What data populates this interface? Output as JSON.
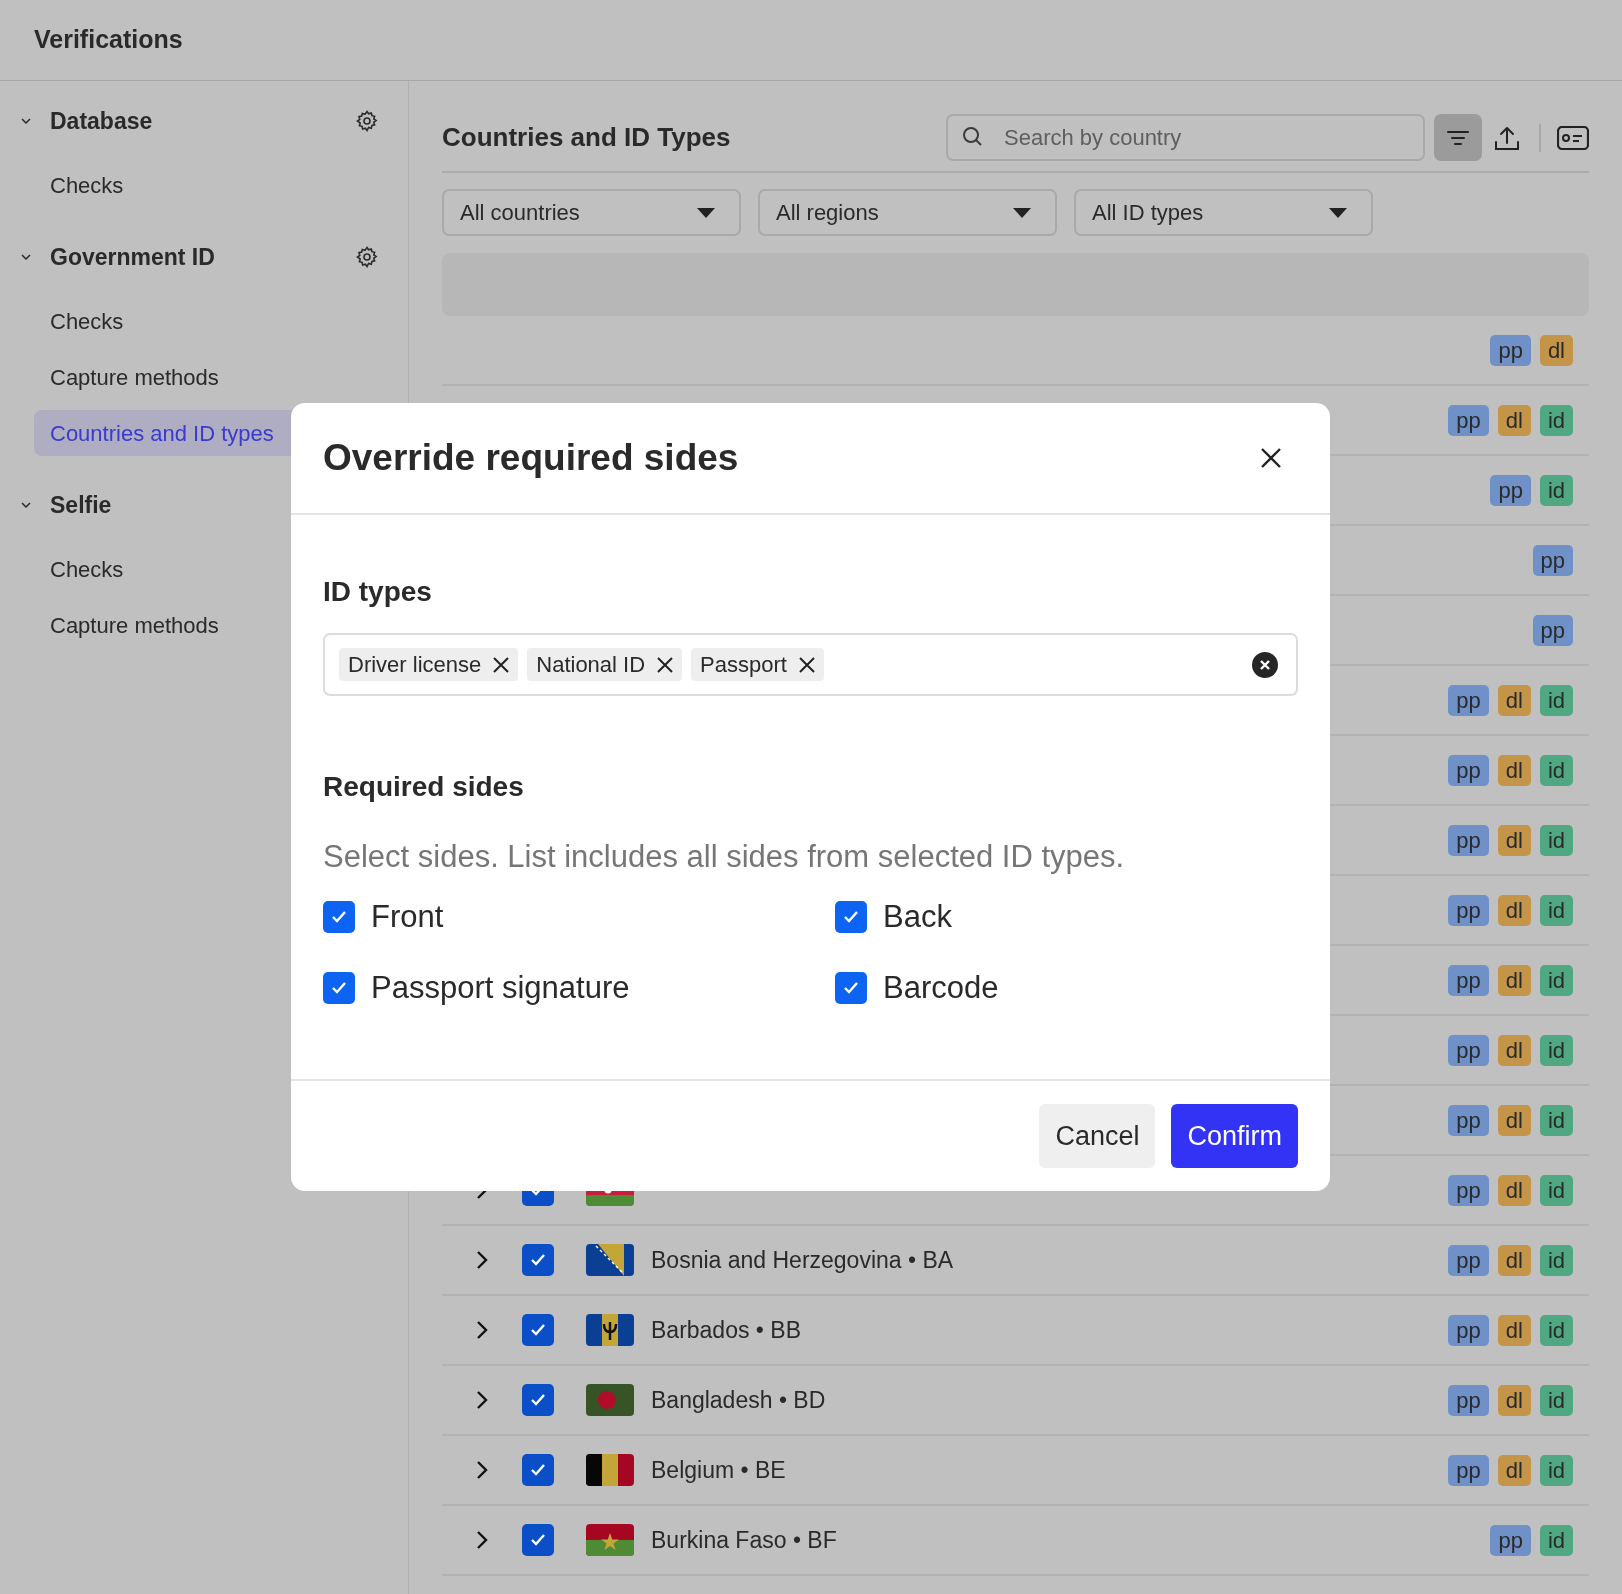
{
  "app": {
    "title": "Verifications"
  },
  "sidebar": {
    "sections": [
      {
        "label": "Database",
        "expanded": true,
        "settings": true,
        "items": [
          {
            "label": "Checks",
            "selected": false
          }
        ]
      },
      {
        "label": "Government ID",
        "expanded": true,
        "settings": true,
        "items": [
          {
            "label": "Checks",
            "selected": false
          },
          {
            "label": "Capture methods",
            "selected": false
          },
          {
            "label": "Countries and ID types",
            "selected": true
          }
        ]
      },
      {
        "label": "Selfie",
        "expanded": true,
        "settings": false,
        "items": [
          {
            "label": "Checks",
            "selected": false
          },
          {
            "label": "Capture methods",
            "selected": false
          }
        ]
      }
    ]
  },
  "main": {
    "title": "Countries and ID Types",
    "search": {
      "placeholder": "Search by country"
    },
    "filter_active": true,
    "filters": [
      "All countries",
      "All regions",
      "All ID types"
    ],
    "rows": [
      {
        "badges": [
          {
            "label": "pp",
            "color": "#7090c8"
          },
          {
            "label": "dl",
            "color": "#c49448"
          }
        ]
      },
      {
        "badges": [
          {
            "label": "pp",
            "color": "#7090c8"
          },
          {
            "label": "dl",
            "color": "#c49448"
          },
          {
            "label": "id",
            "color": "#50a882"
          }
        ]
      },
      {
        "badges": [
          {
            "label": "pp",
            "color": "#7090c8"
          },
          {
            "label": "id",
            "color": "#50a882"
          }
        ]
      },
      {
        "badges": [
          {
            "label": "pp",
            "color": "#7090c8"
          }
        ]
      },
      {
        "badges": [
          {
            "label": "pp",
            "color": "#7090c8"
          }
        ]
      },
      {
        "badges": [
          {
            "label": "pp",
            "color": "#7090c8"
          },
          {
            "label": "dl",
            "color": "#c49448"
          },
          {
            "label": "id",
            "color": "#50a882"
          }
        ]
      },
      {
        "badges": [
          {
            "label": "pp",
            "color": "#7090c8"
          },
          {
            "label": "dl",
            "color": "#c49448"
          },
          {
            "label": "id",
            "color": "#50a882"
          }
        ]
      },
      {
        "badges": [
          {
            "label": "pp",
            "color": "#7090c8"
          },
          {
            "label": "dl",
            "color": "#c49448"
          },
          {
            "label": "id",
            "color": "#50a882"
          }
        ]
      },
      {
        "badges": [
          {
            "label": "pp",
            "color": "#7090c8"
          },
          {
            "label": "dl",
            "color": "#c49448"
          },
          {
            "label": "id",
            "color": "#50a882"
          }
        ]
      },
      {
        "badges": [
          {
            "label": "pp",
            "color": "#7090c8"
          },
          {
            "label": "dl",
            "color": "#c49448"
          },
          {
            "label": "id",
            "color": "#50a882"
          }
        ]
      },
      {
        "badges": [
          {
            "label": "pp",
            "color": "#7090c8"
          },
          {
            "label": "dl",
            "color": "#c49448"
          },
          {
            "label": "id",
            "color": "#50a882"
          }
        ]
      },
      {
        "badges": [
          {
            "label": "pp",
            "color": "#7090c8"
          },
          {
            "label": "dl",
            "color": "#c49448"
          },
          {
            "label": "id",
            "color": "#50a882"
          }
        ]
      },
      {
        "checked": true,
        "badges": [
          {
            "label": "pp",
            "color": "#7090c8"
          },
          {
            "label": "dl",
            "color": "#c49448"
          },
          {
            "label": "id",
            "color": "#50a882"
          }
        ]
      },
      {
        "name": "Bosnia and Herzegovina • BA",
        "checked": true,
        "badges": [
          {
            "label": "pp",
            "color": "#7090c8"
          },
          {
            "label": "dl",
            "color": "#c49448"
          },
          {
            "label": "id",
            "color": "#50a882"
          }
        ]
      },
      {
        "name": "Barbados • BB",
        "checked": true,
        "badges": [
          {
            "label": "pp",
            "color": "#7090c8"
          },
          {
            "label": "dl",
            "color": "#c49448"
          },
          {
            "label": "id",
            "color": "#50a882"
          }
        ]
      },
      {
        "name": "Bangladesh • BD",
        "checked": true,
        "badges": [
          {
            "label": "pp",
            "color": "#7090c8"
          },
          {
            "label": "dl",
            "color": "#c49448"
          },
          {
            "label": "id",
            "color": "#50a882"
          }
        ]
      },
      {
        "name": "Belgium • BE",
        "checked": true,
        "badges": [
          {
            "label": "pp",
            "color": "#7090c8"
          },
          {
            "label": "dl",
            "color": "#c49448"
          },
          {
            "label": "id",
            "color": "#50a882"
          }
        ]
      },
      {
        "name": "Burkina Faso • BF",
        "checked": true,
        "badges": [
          {
            "label": "pp",
            "color": "#7090c8"
          },
          {
            "label": "id",
            "color": "#50a882"
          }
        ]
      }
    ]
  },
  "dialog": {
    "title": "Override required sides",
    "id_types": {
      "label": "ID types",
      "chips": [
        "Driver license",
        "National ID",
        "Passport"
      ]
    },
    "required_sides": {
      "label": "Required sides",
      "hint": "Select sides. List includes all sides from selected ID types.",
      "options": [
        {
          "label": "Front",
          "checked": true
        },
        {
          "label": "Back",
          "checked": true
        },
        {
          "label": "Passport signature",
          "checked": true
        },
        {
          "label": "Barcode",
          "checked": true
        }
      ]
    },
    "buttons": {
      "cancel": "Cancel",
      "confirm": "Confirm"
    }
  }
}
